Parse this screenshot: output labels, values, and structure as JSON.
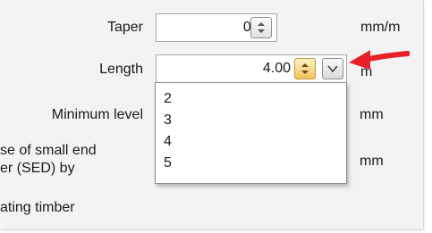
{
  "taper": {
    "label": "Taper",
    "value": "0.00",
    "unit": "mm/m"
  },
  "length": {
    "label": "Length",
    "value": "4.00",
    "unit": "m",
    "options": [
      "2",
      "3",
      "4",
      "5"
    ]
  },
  "minimum_level": {
    "label": "Minimum level",
    "unit": "mm"
  },
  "sed": {
    "label_line1": "se of small end",
    "label_line2": "er (SED) by",
    "unit": "mm"
  },
  "floating": {
    "label": "ating timber"
  },
  "colors": {
    "annotation_arrow": "#e8202a",
    "spin_active": "#f4c35a"
  },
  "icons": [
    "spin-up-down-icon",
    "chevron-down-icon",
    "red-pointer-arrow"
  ]
}
